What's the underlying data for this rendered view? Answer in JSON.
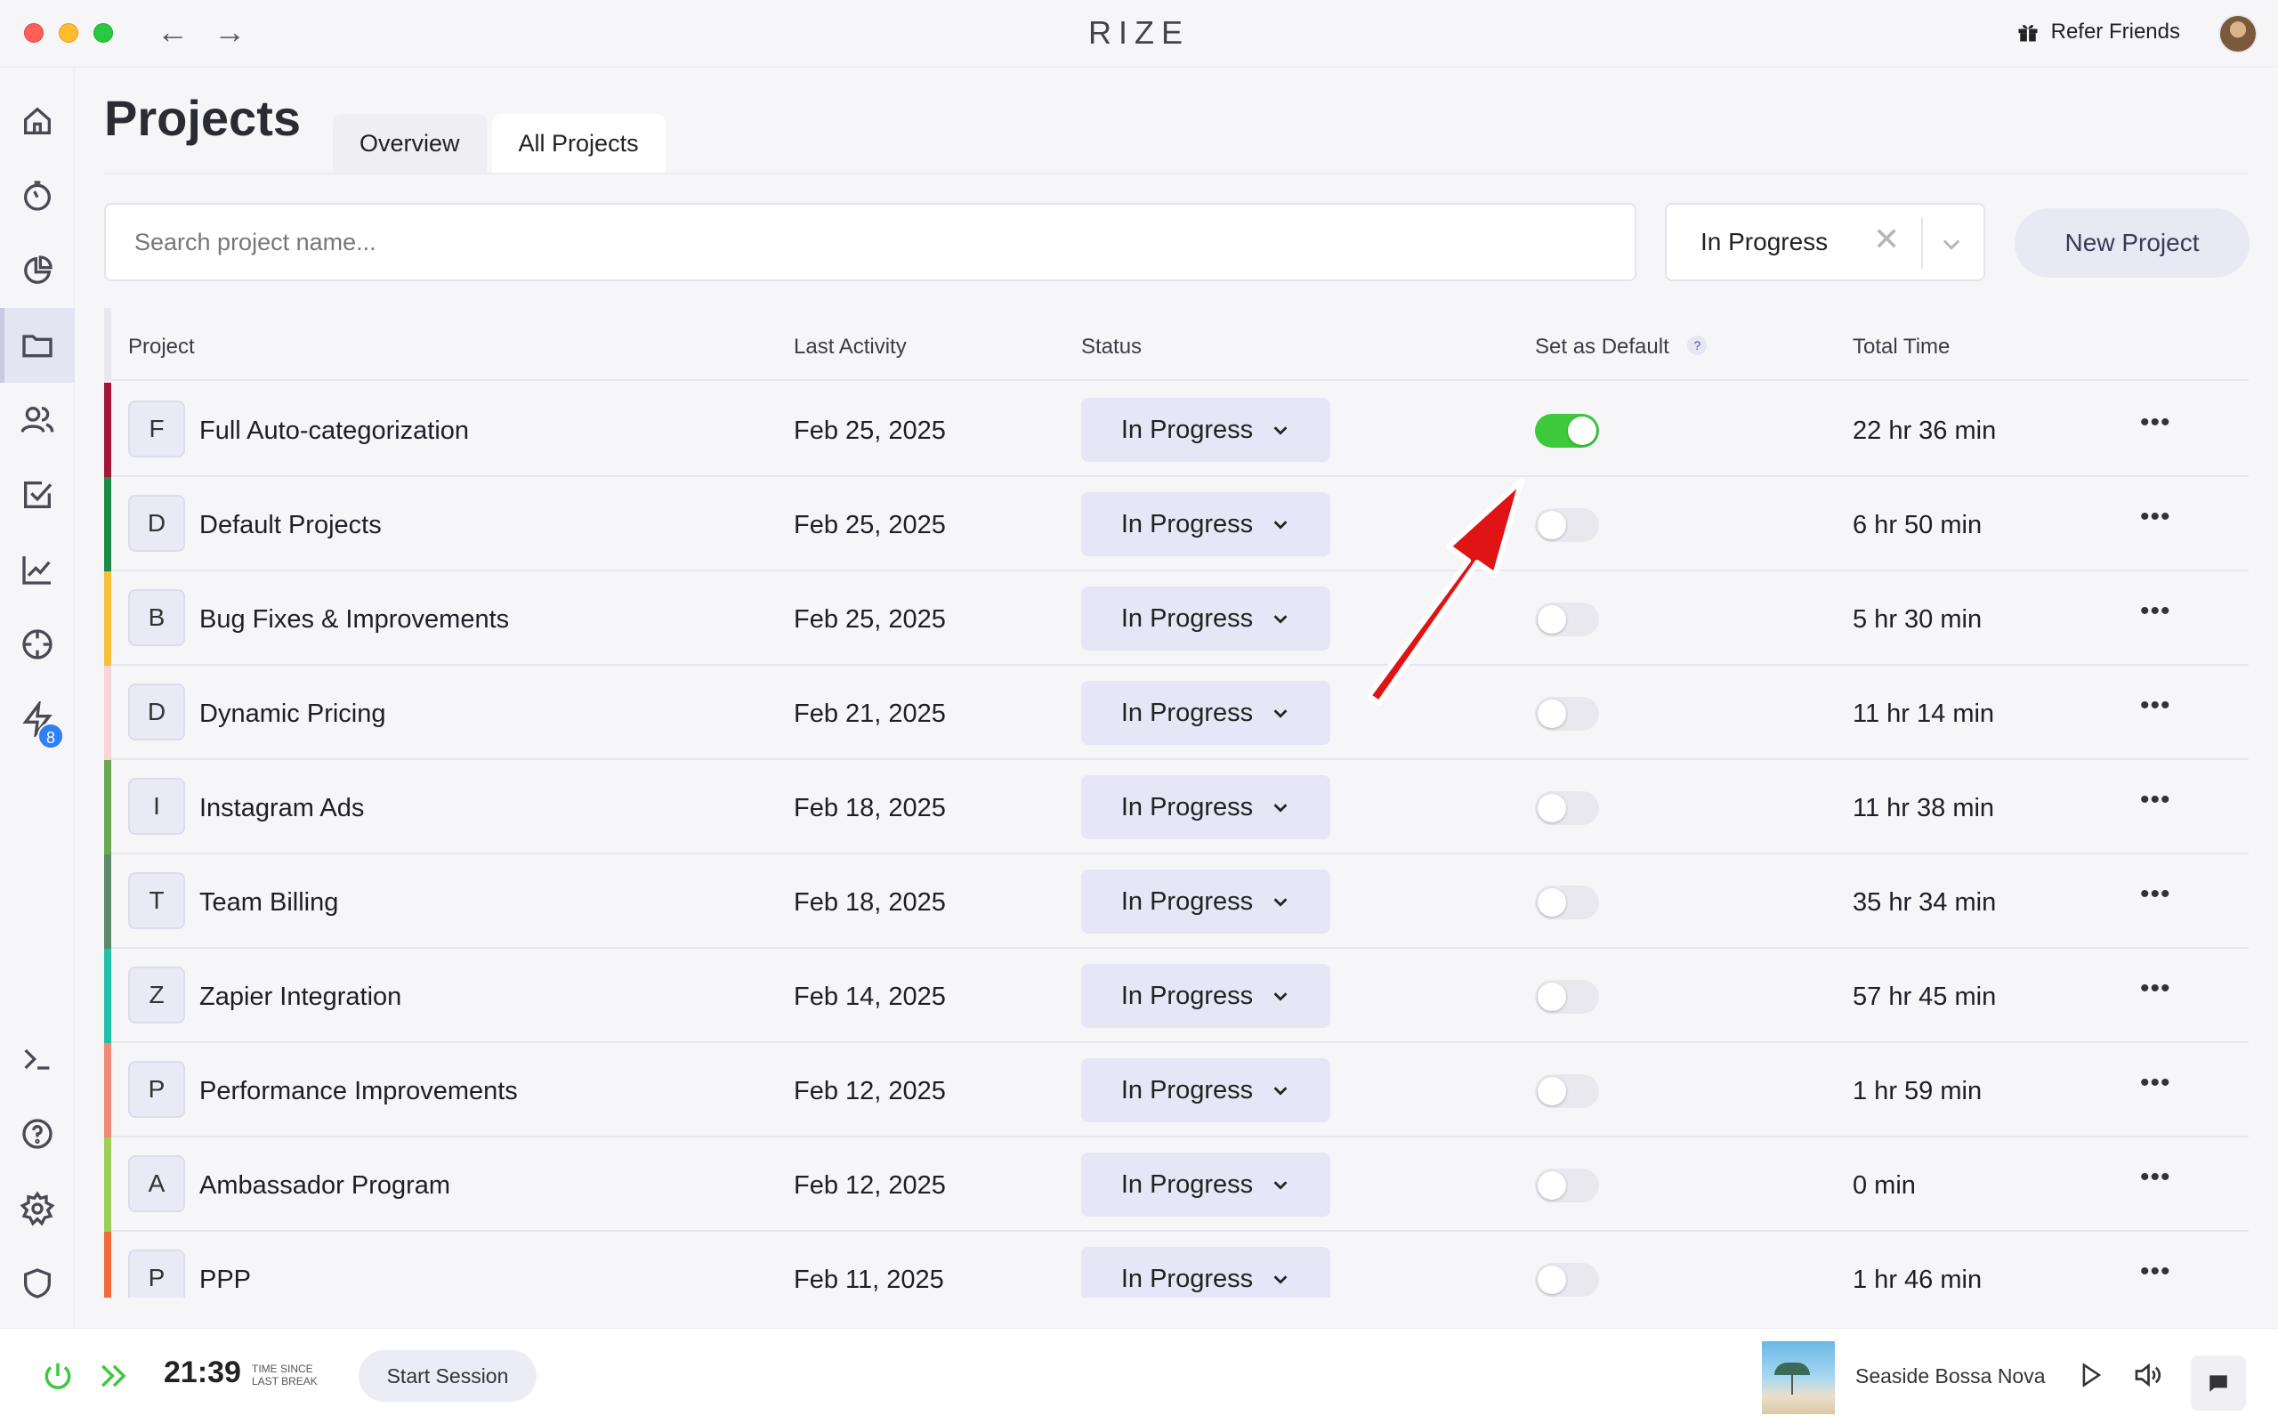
{
  "app": {
    "brand": "RIZE",
    "refer_label": "Refer Friends"
  },
  "sidebar": {
    "items": [
      {
        "name": "home",
        "icon": "home-icon"
      },
      {
        "name": "timer",
        "icon": "stopwatch-icon"
      },
      {
        "name": "reports",
        "icon": "pie-chart-icon"
      },
      {
        "name": "projects",
        "icon": "folder-icon",
        "active": true
      },
      {
        "name": "clients",
        "icon": "users-icon"
      },
      {
        "name": "tasks",
        "icon": "checkbox-icon"
      },
      {
        "name": "analytics",
        "icon": "trend-chart-icon"
      },
      {
        "name": "focus",
        "icon": "crosshair-icon"
      },
      {
        "name": "integrations",
        "icon": "lightning-icon",
        "badge": "8"
      },
      {
        "name": "terminal",
        "icon": "terminal-icon"
      },
      {
        "name": "help",
        "icon": "help-circle-icon"
      },
      {
        "name": "settings",
        "icon": "gear-icon"
      },
      {
        "name": "privacy",
        "icon": "shield-icon"
      }
    ],
    "badge_count": "8"
  },
  "page": {
    "title": "Projects",
    "tabs": [
      "Overview",
      "All Projects"
    ],
    "active_tab": "All Projects"
  },
  "toolbar": {
    "search_placeholder": "Search project name...",
    "filter_value": "In Progress",
    "clear_glyph": "✕",
    "new_project_label": "New Project"
  },
  "table": {
    "headers": {
      "project": "Project",
      "last_activity": "Last Activity",
      "status": "Status",
      "set_default": "Set as Default",
      "help": "?",
      "total_time": "Total Time"
    },
    "rows": [
      {
        "letter": "F",
        "name": "Full Auto-categorization",
        "last_activity": "Feb 25, 2025",
        "status": "In Progress",
        "default": true,
        "total_time": "22 hr 36 min",
        "color": "#a3163a"
      },
      {
        "letter": "D",
        "name": "Default Projects",
        "last_activity": "Feb 25, 2025",
        "status": "In Progress",
        "default": false,
        "total_time": "6 hr 50 min",
        "color": "#1e8a4a"
      },
      {
        "letter": "B",
        "name": "Bug Fixes & Improvements",
        "last_activity": "Feb 25, 2025",
        "status": "In Progress",
        "default": false,
        "total_time": "5 hr 30 min",
        "color": "#f5c13a"
      },
      {
        "letter": "D",
        "name": "Dynamic Pricing",
        "last_activity": "Feb 21, 2025",
        "status": "In Progress",
        "default": false,
        "total_time": "11 hr 14 min",
        "color": "#f9d4d8"
      },
      {
        "letter": "I",
        "name": "Instagram Ads",
        "last_activity": "Feb 18, 2025",
        "status": "In Progress",
        "default": false,
        "total_time": "11 hr 38 min",
        "color": "#6aa84f"
      },
      {
        "letter": "T",
        "name": "Team Billing",
        "last_activity": "Feb 18, 2025",
        "status": "In Progress",
        "default": false,
        "total_time": "35 hr 34 min",
        "color": "#5a8a6a"
      },
      {
        "letter": "Z",
        "name": "Zapier Integration",
        "last_activity": "Feb 14, 2025",
        "status": "In Progress",
        "default": false,
        "total_time": "57 hr 45 min",
        "color": "#1fbfa8"
      },
      {
        "letter": "P",
        "name": "Performance Improvements",
        "last_activity": "Feb 12, 2025",
        "status": "In Progress",
        "default": false,
        "total_time": "1 hr 59 min",
        "color": "#f08a78"
      },
      {
        "letter": "A",
        "name": "Ambassador Program",
        "last_activity": "Feb 12, 2025",
        "status": "In Progress",
        "default": false,
        "total_time": "0 min",
        "color": "#9ccf55"
      },
      {
        "letter": "P",
        "name": "PPP",
        "last_activity": "Feb 11, 2025",
        "status": "In Progress",
        "default": false,
        "total_time": "1 hr 46 min",
        "color": "#f06a3a"
      }
    ]
  },
  "footer": {
    "timer": "21:39",
    "since_line1": "TIME SINCE",
    "since_line2": "LAST BREAK",
    "start_session_label": "Start Session",
    "track_name": "Seaside Bossa Nova"
  },
  "colors": {
    "toggle_on": "#3cc93c",
    "accent_badge": "#2f7ff5",
    "annotation_arrow": "#e01414"
  }
}
